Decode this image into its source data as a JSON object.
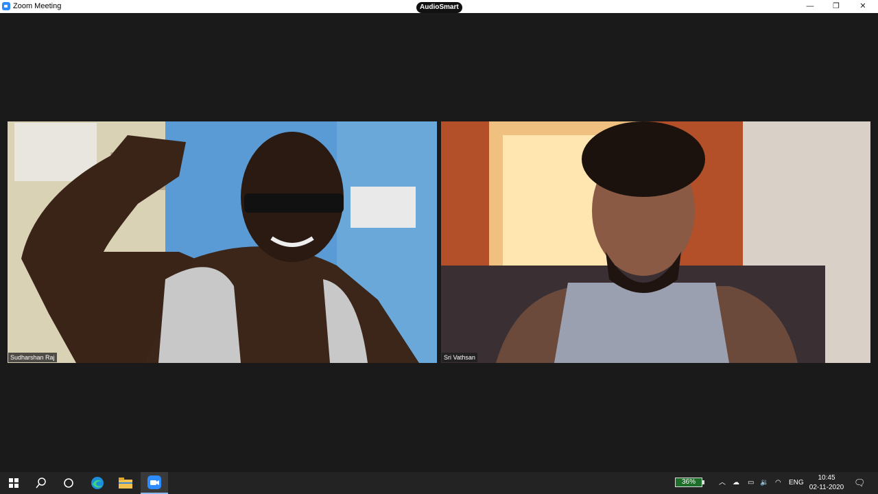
{
  "window": {
    "title": "Zoom Meeting",
    "badge": "AudioSmart",
    "controls": {
      "minimize": "—",
      "maximize": "❐",
      "close": "✕"
    }
  },
  "participants": [
    {
      "name": "Sudharshan Raj"
    },
    {
      "name": "Sri Vathsan"
    }
  ],
  "taskbar": {
    "apps": [
      {
        "icon": "windows-start-icon"
      },
      {
        "icon": "search-icon"
      },
      {
        "icon": "task-view-icon"
      },
      {
        "icon": "edge-browser-icon"
      },
      {
        "icon": "file-explorer-icon"
      },
      {
        "icon": "zoom-app-icon",
        "active": true
      }
    ],
    "battery": "36%",
    "language": "ENG",
    "time": "10:45",
    "date": "02-11-2020"
  },
  "colors": {
    "background": "#1a1a1a",
    "taskbar": "#232323",
    "zoom_blue": "#2d8cff",
    "battery_green": "#1f6f2c"
  }
}
